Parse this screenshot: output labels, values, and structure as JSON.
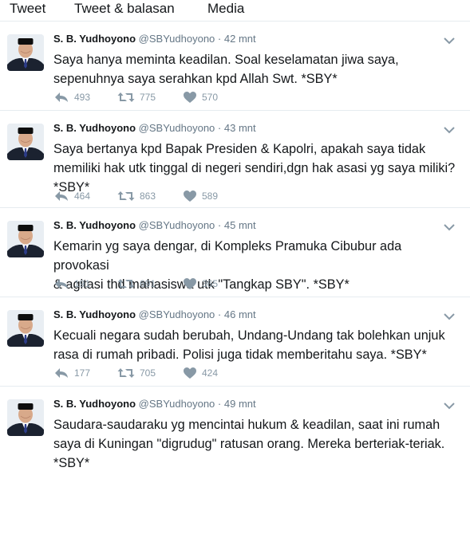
{
  "tabs": [
    "Tweet",
    "Tweet & balasan",
    "Media"
  ],
  "colors": {
    "name": "#14171a",
    "meta": "#657786",
    "action": "#8899a6",
    "divider": "#e6ecf0"
  },
  "tweets": [
    {
      "name": "S. B. Yudhoyono",
      "handle": "@SBYudhoyono",
      "sep": "·",
      "time": "42 mnt",
      "text": "Saya hanya meminta keadilan. Soal keselamatan jiwa saya,\nsepenuhnya saya serahkan kpd Allah Swt. *SBY*",
      "replies": "493",
      "retweets": "775",
      "likes": "570"
    },
    {
      "name": "S. B. Yudhoyono",
      "handle": "@SBYudhoyono",
      "sep": "·",
      "time": "43 mnt",
      "text": "Saya bertanya kpd Bapak Presiden & Kapolri, apakah saya tidak\nmemiliki hak utk tinggal di negeri sendiri,dgn hak asasi yg saya miliki?\n*SBY*",
      "replies": "464",
      "retweets": "863",
      "likes": "589"
    },
    {
      "name": "S. B. Yudhoyono",
      "handle": "@SBYudhoyono",
      "sep": "·",
      "time": "45 mnt",
      "text": "Kemarin yg saya dengar, di Kompleks Pramuka Cibubur ada provokasi\n& agitasi thd mahasiswa utk \"Tangkap SBY\".  *SBY*",
      "replies": "191",
      "retweets": "691",
      "likes": "365"
    },
    {
      "name": "S. B. Yudhoyono",
      "handle": "@SBYudhoyono",
      "sep": "·",
      "time": "46 mnt",
      "text": "Kecuali negara sudah berubah, Undang-Undang tak bolehkan unjuk\nrasa di rumah pribadi. Polisi juga tidak memberitahu saya. *SBY*",
      "replies": "177",
      "retweets": "705",
      "likes": "424"
    },
    {
      "name": "S. B. Yudhoyono",
      "handle": "@SBYudhoyono",
      "sep": "·",
      "time": "49 mnt",
      "text": "Saudara-saudaraku yg mencintai hukum & keadilan, saat ini rumah\nsaya di Kuningan \"digrudug\" ratusan orang. Mereka berteriak-teriak.\n*SBY*"
    }
  ]
}
